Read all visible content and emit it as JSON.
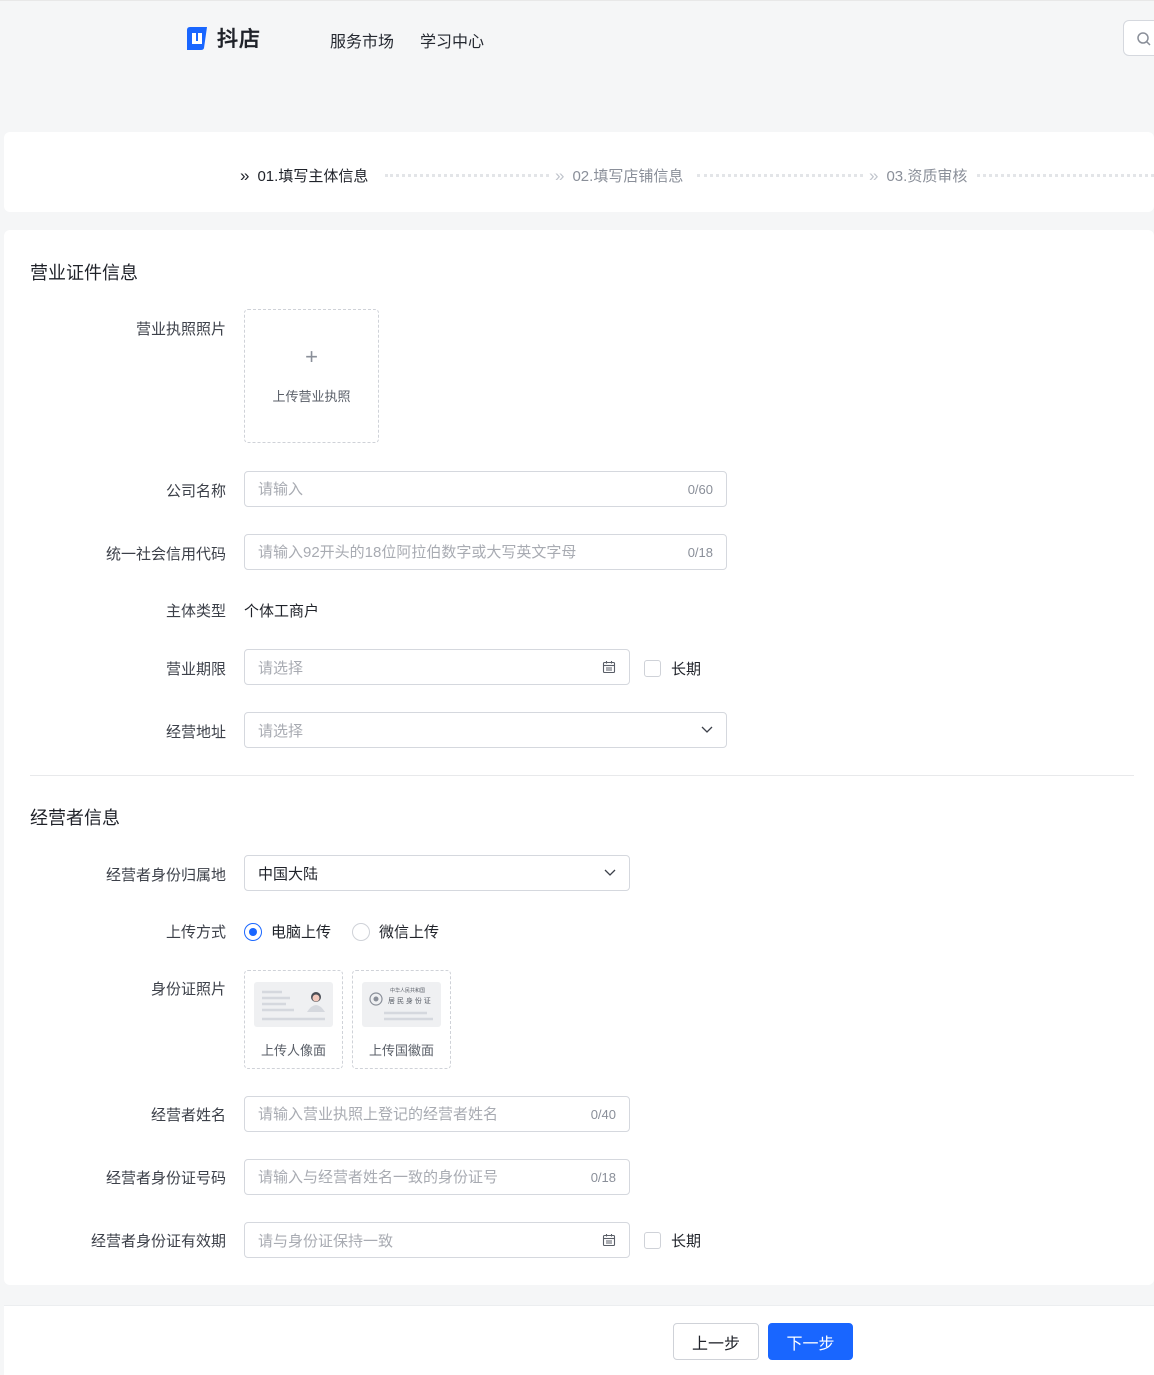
{
  "header": {
    "logo_text": "抖店",
    "nav": [
      "服务市场",
      "学习中心"
    ],
    "brand_color": "#1966ff"
  },
  "steps": [
    {
      "label": "01.填写主体信息",
      "active": true
    },
    {
      "label": "02.填写店铺信息",
      "active": false
    },
    {
      "label": "03.资质审核",
      "active": false
    }
  ],
  "business": {
    "section_title": "营业证件信息",
    "license_photo": {
      "label": "营业执照照片",
      "upload_text": "上传营业执照"
    },
    "company_name": {
      "label": "公司名称",
      "placeholder": "请输入",
      "count": "0/60"
    },
    "credit_code": {
      "label": "统一社会信用代码",
      "placeholder": "请输入92开头的18位阿拉伯数字或大写英文字母",
      "count": "0/18"
    },
    "entity_type": {
      "label": "主体类型",
      "value": "个体工商户"
    },
    "term": {
      "label": "营业期限",
      "placeholder": "请选择",
      "long_term": "长期"
    },
    "address": {
      "label": "经营地址",
      "placeholder": "请选择"
    }
  },
  "operator": {
    "section_title": "经营者信息",
    "id_region": {
      "label": "经营者身份归属地",
      "value": "中国大陆"
    },
    "upload_method": {
      "label": "上传方式",
      "options": [
        "电脑上传",
        "微信上传"
      ],
      "selected": "电脑上传"
    },
    "id_photo": {
      "label": "身份证照片",
      "front_text": "上传人像面",
      "back_text": "上传国徽面",
      "back_card_title": "中华人民共和国",
      "back_card_subtitle": "居 民 身 份 证"
    },
    "name": {
      "label": "经营者姓名",
      "placeholder": "请输入营业执照上登记的经营者姓名",
      "count": "0/40"
    },
    "id_number": {
      "label": "经营者身份证号码",
      "placeholder": "请输入与经营者姓名一致的身份证号",
      "count": "0/18"
    },
    "id_validity": {
      "label": "经营者身份证有效期",
      "placeholder": "请与身份证保持一致",
      "long_term": "长期"
    }
  },
  "footer": {
    "prev_label": "上一步",
    "next_label": "下一步"
  }
}
